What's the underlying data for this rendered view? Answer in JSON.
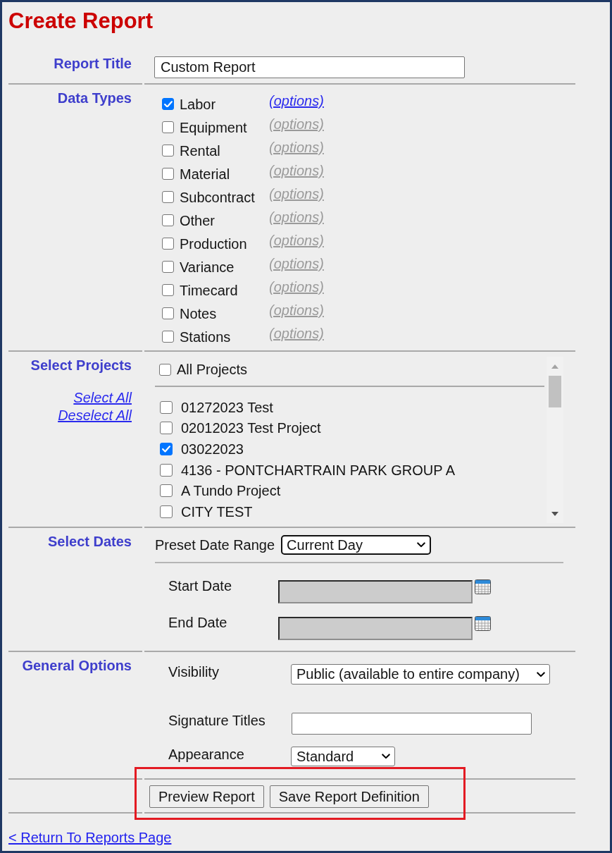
{
  "page": {
    "title": "Create Report"
  },
  "report_title": {
    "label": "Report Title",
    "value": "Custom Report"
  },
  "data_types": {
    "label": "Data Types",
    "items": [
      {
        "label": "Labor",
        "checked": true,
        "options_link": "(options)",
        "options_disabled": false
      },
      {
        "label": "Equipment",
        "checked": false,
        "options_link": "(options)",
        "options_disabled": true
      },
      {
        "label": "Rental",
        "checked": false,
        "options_link": "(options)",
        "options_disabled": true
      },
      {
        "label": "Material",
        "checked": false,
        "options_link": "(options)",
        "options_disabled": true
      },
      {
        "label": "Subcontract",
        "checked": false,
        "options_link": "(options)",
        "options_disabled": true
      },
      {
        "label": "Other",
        "checked": false,
        "options_link": "(options)",
        "options_disabled": true
      },
      {
        "label": "Production",
        "checked": false,
        "options_link": "(options)",
        "options_disabled": true
      },
      {
        "label": "Variance",
        "checked": false,
        "options_link": "(options)",
        "options_disabled": true
      },
      {
        "label": "Timecard",
        "checked": false,
        "options_link": "(options)",
        "options_disabled": true
      },
      {
        "label": "Notes",
        "checked": false,
        "options_link": "(options)",
        "options_disabled": true
      },
      {
        "label": "Stations",
        "checked": false,
        "options_link": "(options)",
        "options_disabled": true
      }
    ]
  },
  "projects": {
    "label": "Select Projects",
    "select_all": "Select All",
    "deselect_all": "Deselect All",
    "all_projects": {
      "label": "All Projects",
      "checked": false
    },
    "items": [
      {
        "label": "01272023 Test",
        "checked": false
      },
      {
        "label": "02012023 Test Project",
        "checked": false
      },
      {
        "label": "03022023",
        "checked": true
      },
      {
        "label": "4136 - PONTCHARTRAIN PARK GROUP A",
        "checked": false
      },
      {
        "label": "A Tundo Project",
        "checked": false
      },
      {
        "label": "CITY TEST",
        "checked": false
      }
    ]
  },
  "dates": {
    "label": "Select Dates",
    "preset": {
      "label": "Preset Date Range",
      "value": "Current Day",
      "focused": true
    },
    "fields": [
      {
        "label": "Start Date",
        "disabled": true
      },
      {
        "label": "End Date",
        "disabled": true
      }
    ]
  },
  "general_options": {
    "label": "General Options",
    "visibility": {
      "label": "Visibility",
      "value": "Public (available to entire company)"
    },
    "signature_titles": {
      "label": "Signature Titles"
    },
    "appearance": {
      "label": "Appearance",
      "value": "Standard"
    }
  },
  "actions": {
    "highlighted": true,
    "buttons": [
      "Preview Report",
      "Save Report Definition"
    ]
  },
  "footer_link": "< Return To Reports Page"
}
